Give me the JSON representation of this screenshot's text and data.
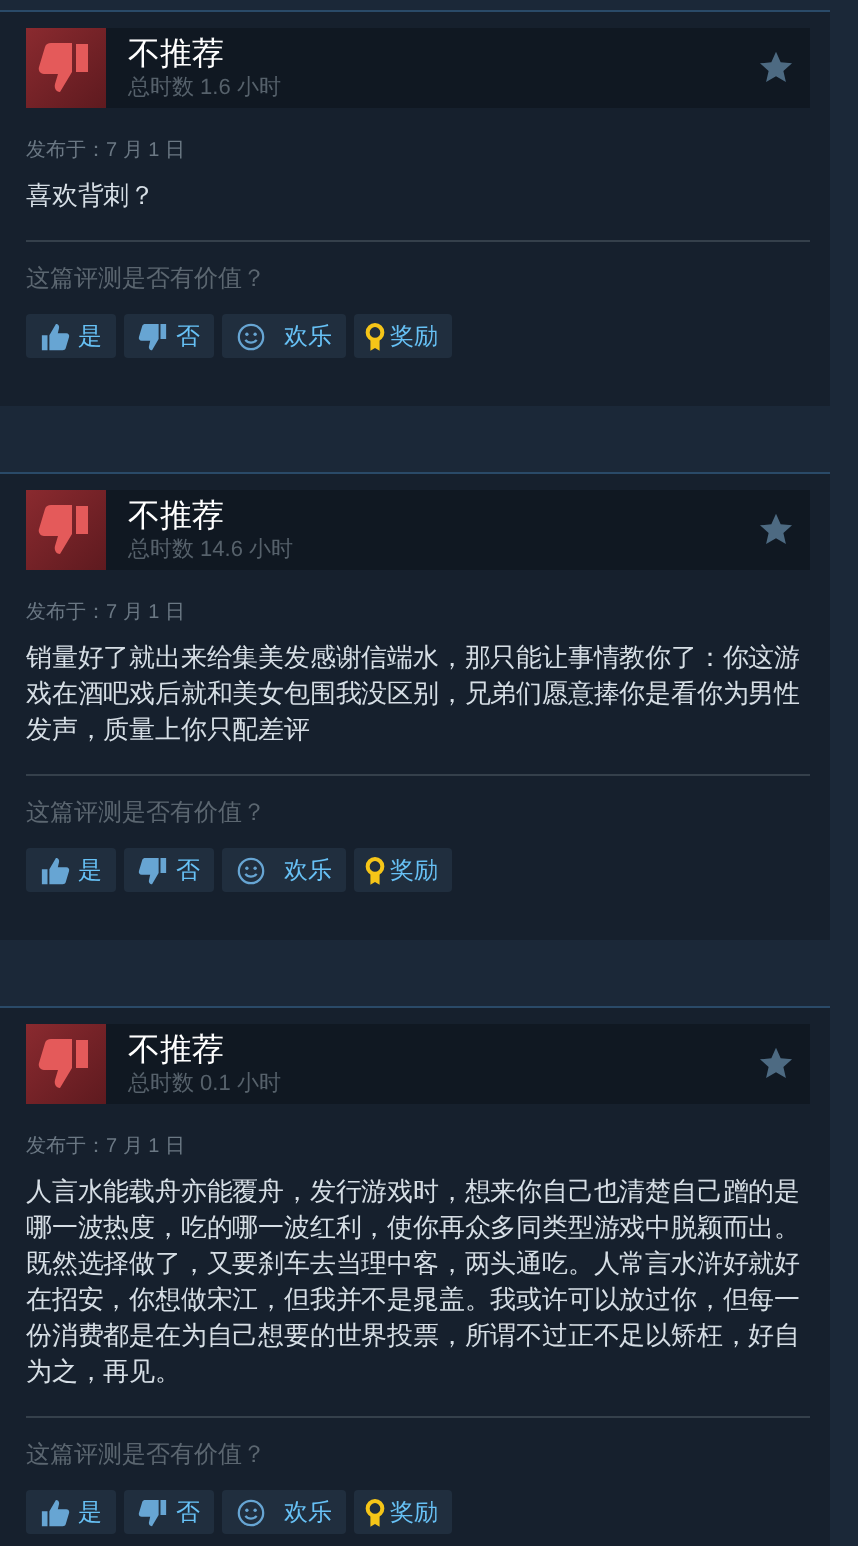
{
  "reviews": [
    {
      "recommended": false,
      "verdict": "不推荐",
      "hours": "总时数 1.6 小时",
      "date": "发布于：7 月 1 日",
      "body": "喜欢背刺？",
      "question": "这篇评测是否有价值？",
      "buttons": [
        {
          "kind": "yes",
          "label": "是"
        },
        {
          "kind": "no",
          "label": "否"
        },
        {
          "kind": "funny",
          "label": "欢乐"
        },
        {
          "kind": "award",
          "label": "奖励"
        }
      ]
    },
    {
      "recommended": false,
      "verdict": "不推荐",
      "hours": "总时数 14.6 小时",
      "date": "发布于：7 月 1 日",
      "body": "销量好了就出来给集美发感谢信端水，那只能让事情教你了：你这游戏在酒吧戏后就和美女包围我没区别，兄弟们愿意捧你是看你为男性发声，质量上你只配差评",
      "question": "这篇评测是否有价值？",
      "buttons": [
        {
          "kind": "yes",
          "label": "是"
        },
        {
          "kind": "no",
          "label": "否"
        },
        {
          "kind": "funny",
          "label": "欢乐"
        },
        {
          "kind": "award",
          "label": "奖励"
        }
      ]
    },
    {
      "recommended": false,
      "verdict": "不推荐",
      "hours": "总时数 0.1 小时",
      "date": "发布于：7 月 1 日",
      "body": "人言水能载舟亦能覆舟，发行游戏时，想来你自己也清楚自己蹭的是哪一波热度，吃的哪一波红利，使你再众多同类型游戏中脱颖而出。既然选择做了，又要刹车去当理中客，两头通吃。人常言水浒好就好在招安，你想做宋江，但我并不是晁盖。我或许可以放过你，但每一份消费都是在为自己想要的世界投票，所谓不过正不足以矫枉，好自为之，再见。",
      "question": "这篇评测是否有价值？",
      "buttons": [
        {
          "kind": "yes",
          "label": "是"
        },
        {
          "kind": "no",
          "label": "否"
        },
        {
          "kind": "funny",
          "label": "欢乐"
        },
        {
          "kind": "award",
          "label": "奖励"
        }
      ]
    }
  ]
}
